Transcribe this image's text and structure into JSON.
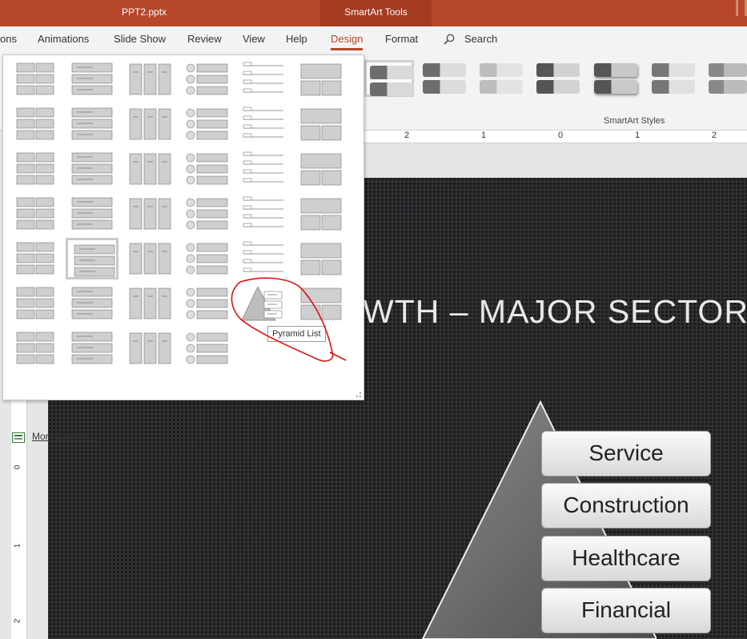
{
  "window": {
    "doc_title": "PPT2.pptx",
    "contextual_tab": "SmartArt Tools"
  },
  "ribbon_tabs": [
    {
      "label": "ons"
    },
    {
      "label": "Animations"
    },
    {
      "label": "Slide Show"
    },
    {
      "label": "Review"
    },
    {
      "label": "View"
    },
    {
      "label": "Help"
    },
    {
      "label": "Design",
      "active": true
    },
    {
      "label": "Format"
    }
  ],
  "search": {
    "label": "Search",
    "icon": "search-icon"
  },
  "smartart_styles": {
    "group_label": "SmartArt Styles"
  },
  "gallery": {
    "selected_index": 25,
    "hovered_layout": "Pyramid List",
    "more_layouts_label": "More Layouts..."
  },
  "ruler": {
    "horizontal": [
      "2",
      "1",
      "0",
      "1",
      "2"
    ],
    "vertical": [
      "0",
      "1",
      "2"
    ]
  },
  "slide": {
    "title": "WTH – MAJOR SECTORS",
    "sectors": [
      "Service",
      "Construction",
      "Healthcare",
      "Financial"
    ]
  },
  "colors": {
    "accent": "#b7472a",
    "title_bar": "#b7472a",
    "annotation": "#e01010"
  }
}
